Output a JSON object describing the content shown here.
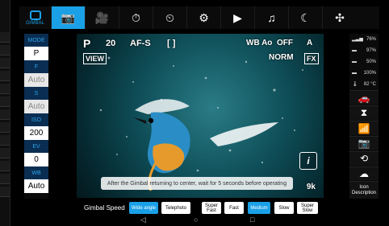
{
  "top_bar": {
    "logo_text": "GIMBAL",
    "icons": [
      "camera-icon",
      "video-icon",
      "timelapse-icon",
      "hyperlapse-icon",
      "settings-camera-icon",
      "playback-icon",
      "music-icon",
      "night-icon",
      "fan-icon"
    ],
    "active_icon": "camera-icon"
  },
  "left_controls": {
    "mode_label": "MODE",
    "mode_value": "P",
    "f_label": "F",
    "f_value": "Auto",
    "s_label": "S",
    "s_value": "Auto",
    "iso_label": "ISO",
    "iso_value": "200",
    "ev_label": "EV",
    "ev_value": "0",
    "wb_label": "WB",
    "wb_value": "Auto"
  },
  "viewport": {
    "top_left_mode": "P",
    "shots": "20",
    "af_mode": "AF-S",
    "af_area": "[ ]",
    "wb_badge": "WB Ao",
    "flash": "OFF",
    "quality_icon": "A",
    "quality_text": "NORM",
    "fx_badge": "FX",
    "view_badge": "VIEW",
    "shots_left": "9k",
    "info_label": "i",
    "toast": "After the Gimbal returning to center, wait for 5 seconds before operating"
  },
  "right_status": {
    "battery_percent": "76%",
    "bar1": "97%",
    "bar2": "50%",
    "bar3": "100%",
    "temp": "82 °C",
    "icon_description_label": "Icon\nDescription"
  },
  "bottom_bar": {
    "gimbal_speed_label": "Gimbal Speed",
    "speed_options": [
      "Wide angle",
      "Telephoto",
      "Super Fast",
      "Fast",
      "Medium",
      "Slow",
      "Super Slow"
    ],
    "active_speed": "Medium",
    "nav_back": "◁",
    "nav_home": "○",
    "nav_recent": "□"
  }
}
